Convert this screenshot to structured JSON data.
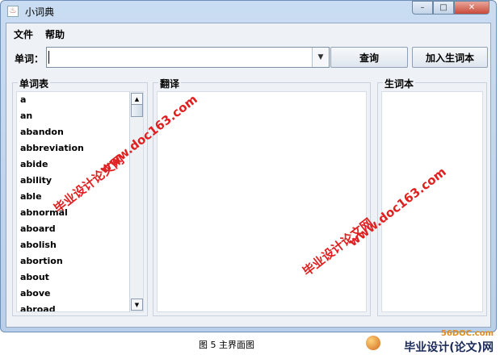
{
  "window": {
    "title": "小词典",
    "controls": {
      "minimize": "–",
      "maximize": "□",
      "close": "✕"
    },
    "app_icon": "java-cup-icon"
  },
  "menubar": {
    "items": [
      "文件",
      "帮助"
    ]
  },
  "search": {
    "label": "单词：",
    "value": "",
    "dropdown_icon": "▼",
    "query_button": "查询",
    "add_button": "加入生词本"
  },
  "panels": {
    "wordlist": {
      "title": "单词表",
      "items": [
        "a",
        "an",
        "abandon",
        "abbreviation",
        "abide",
        "ability",
        "able",
        "abnormal",
        "aboard",
        "abolish",
        "abortion",
        "about",
        "above",
        "abroad"
      ],
      "scroll_up": "▲",
      "scroll_down": "▼"
    },
    "translation": {
      "title": "翻译"
    },
    "vocab": {
      "title": "生词本"
    }
  },
  "watermarks": [
    "www.doc163.com",
    "毕业设计论文网",
    "www.doc163.com",
    "毕业设计论文网"
  ],
  "caption": "图 5    主界面图",
  "footer_logo": {
    "top": "56DOC.com",
    "main": "毕业设计(论文)网"
  }
}
